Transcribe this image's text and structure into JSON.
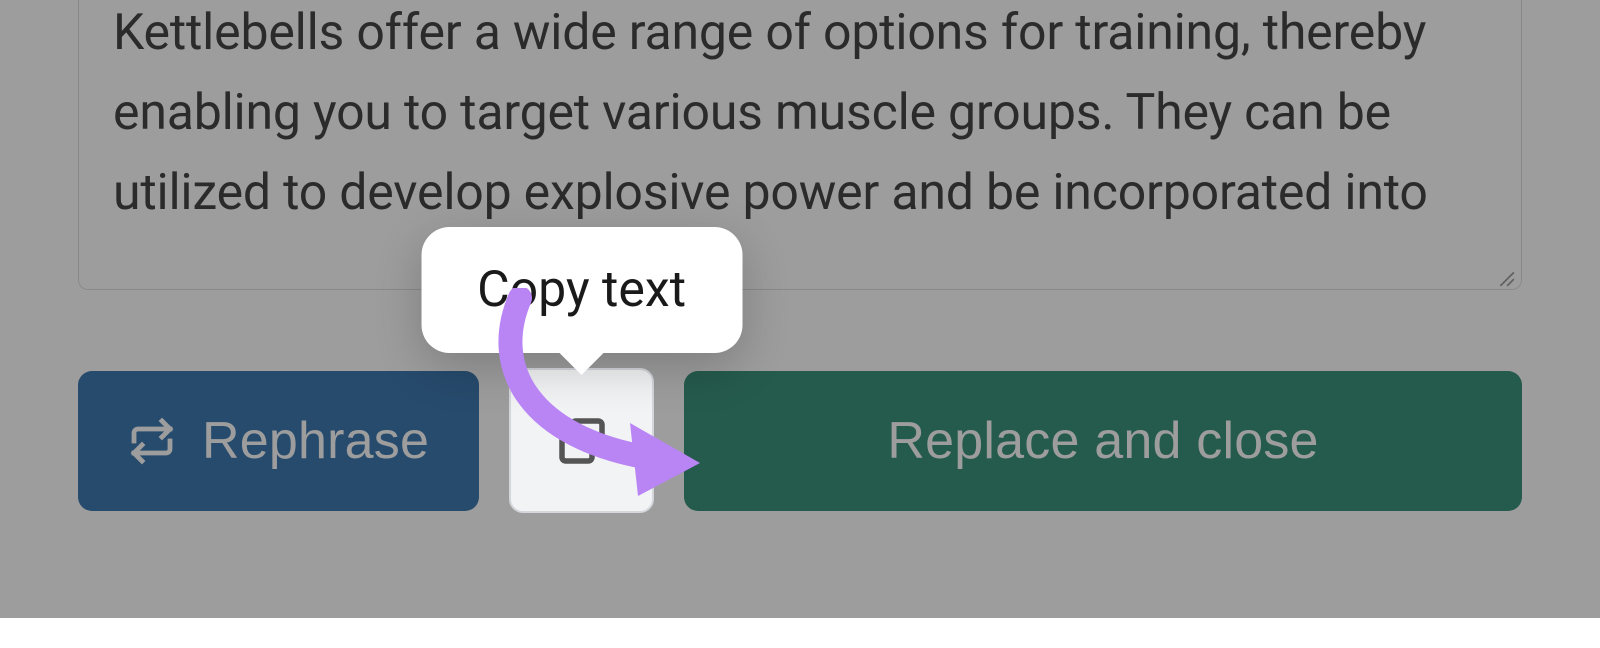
{
  "textarea": {
    "text": "Kettlebells offer a wide range of options for training, thereby enabling you to target various muscle groups. They can be utilized to develop explosive power and be incorporated into"
  },
  "buttons": {
    "rephrase_label": "Rephrase",
    "replace_label": "Replace and close"
  },
  "tooltip": {
    "copy_label": "Copy text"
  },
  "icons": {
    "rephrase": "repeat-icon",
    "copy": "copy-icon"
  }
}
